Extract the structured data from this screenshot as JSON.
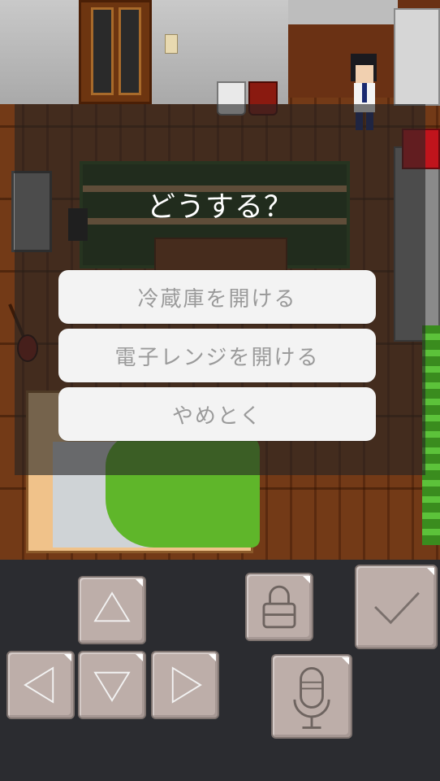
{
  "dialog": {
    "prompt": "どうする？",
    "choices": [
      {
        "label": "冷蔵庫を開ける"
      },
      {
        "label": "電子レンジを開ける"
      },
      {
        "label": "やめとく"
      }
    ]
  },
  "controls": {
    "dpad": [
      "up-arrow-icon",
      "left-arrow-icon",
      "down-arrow-icon",
      "right-arrow-icon"
    ],
    "item_icon": "bag-icon",
    "voice_icon": "microphone-icon",
    "confirm_icon": "checkmark-icon"
  },
  "colors": {
    "panel": "#2b2c30",
    "button": "#bdaea9",
    "choice_bg": "#f3f3f3",
    "choice_text": "#9a9a9a"
  }
}
